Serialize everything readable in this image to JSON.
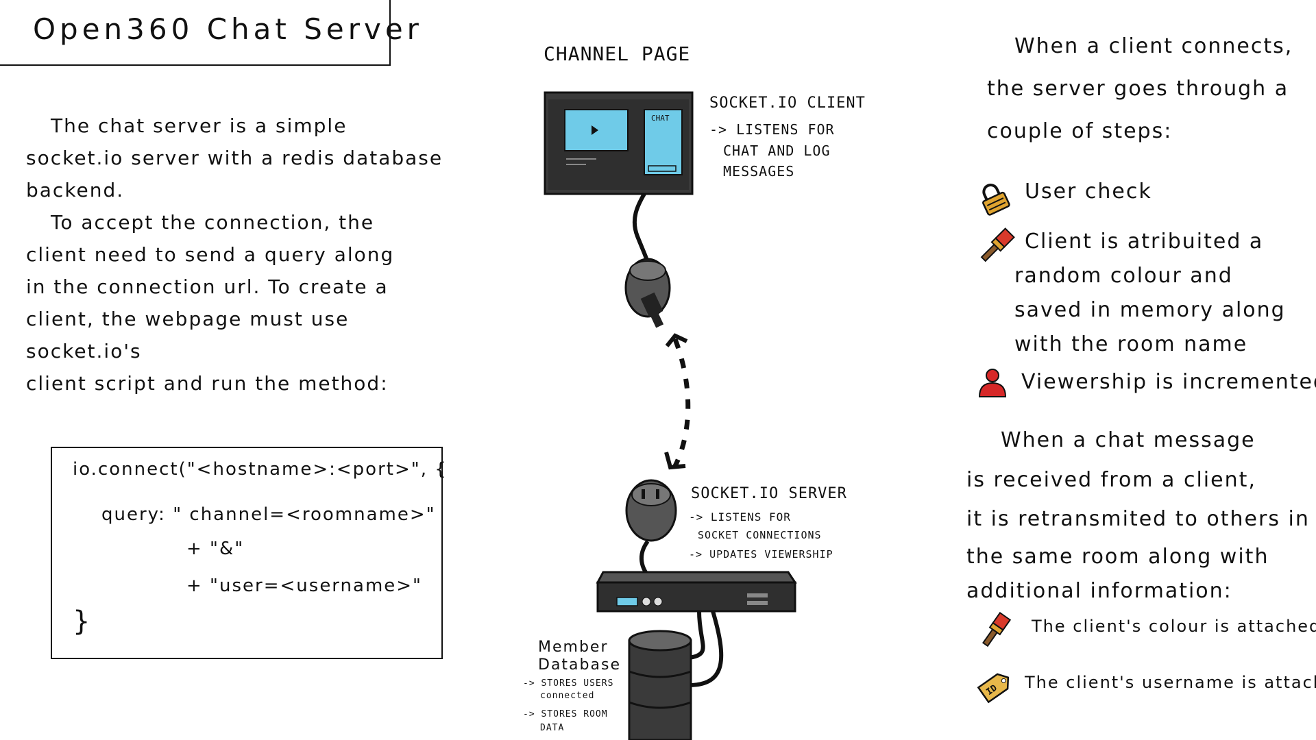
{
  "title": "Open360 Chat Server",
  "intro": {
    "p1": [
      "The chat server is a simple",
      "socket.io server with a redis database",
      "backend."
    ],
    "p2": [
      "To accept the connection, the",
      "client need to send a query along",
      "in the connection url. To create a",
      "client, the webpage must use socket.io's",
      "client script and run the method:"
    ]
  },
  "code": {
    "line1": "io.connect(\"<hostname>:<port>\", {",
    "line2": "query: \" channel=<roomname>\"",
    "line3": "+ \"&\"",
    "line4": "+ \"user=<username>\"",
    "line5": "}"
  },
  "diagram": {
    "channel_page_heading": "CHANNEL PAGE",
    "screen_chat_label": "CHAT",
    "client": {
      "title": "SOCKET.IO CLIENT",
      "notes": [
        "-> LISTENS FOR",
        "CHAT AND LOG",
        "MESSAGES"
      ]
    },
    "server": {
      "title": "SOCKET.IO SERVER",
      "notes": [
        "-> LISTENS FOR",
        "SOCKET CONNECTIONS",
        "-> UPDATES VIEWERSHIP"
      ]
    },
    "database": {
      "title": [
        "Member",
        "Database"
      ],
      "notes": [
        "-> STORES USERS",
        "connected",
        "-> STORES ROOM",
        "DATA"
      ]
    }
  },
  "steps": {
    "intro": [
      "When a client connects,",
      "the server goes through a",
      "couple of steps:"
    ],
    "items": [
      {
        "icon": "lock-icon",
        "lines": [
          "User check"
        ]
      },
      {
        "icon": "paintbrush-icon",
        "lines": [
          "Client is atribuited a",
          "random colour and",
          "saved in memory along",
          "with the room name"
        ]
      },
      {
        "icon": "person-icon",
        "lines": [
          "Viewership is incremented"
        ]
      }
    ]
  },
  "message": {
    "intro": [
      "When a chat message",
      "is received from a client,",
      "it is retransmited to others in",
      "the same room along with",
      "additional information:"
    ],
    "items": [
      {
        "icon": "paintbrush-icon",
        "text": "The client's colour is attached"
      },
      {
        "icon": "id-tag-icon",
        "text": "The client's username is attached"
      }
    ]
  },
  "colors": {
    "screen_blue": "#6fcbe8",
    "device_dark": "#3a3a3a",
    "lock_gold": "#e0a430",
    "brush_red": "#d93a2b",
    "person_red": "#d62828",
    "tag_gold": "#e8b84a"
  }
}
